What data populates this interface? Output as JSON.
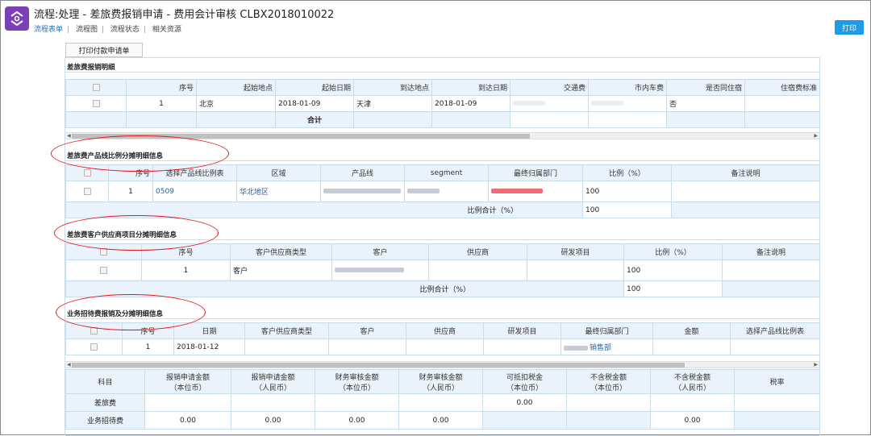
{
  "header": {
    "title": "流程:处理 - 差旅费报销申请 - 费用会计审核 CLBX2018010022",
    "tabs": [
      "流程表单",
      "流程图",
      "流程状态",
      "相关资源"
    ],
    "separator": "|",
    "print_label": "打印",
    "pay_button_label": "打印付款申请单"
  },
  "icons": {
    "logo": "flow-exchange-icon",
    "checkbox": "checkbox-icon"
  },
  "colors": {
    "brand": "#7b3fb8",
    "print": "#1d9be6",
    "header_bg": "#eaf3fb",
    "annotation": "#e0161b"
  },
  "travel": {
    "section_title": "差旅费报销明细",
    "columns": [
      "",
      "序号",
      "起始地点",
      "起始日期",
      "到达地点",
      "到达日期",
      "交通费",
      "市内车费",
      "是否同住宿",
      "住宿费标准"
    ],
    "row": {
      "seq": "1",
      "from": "北京",
      "from_date": "2018-01-09",
      "to": "天津",
      "to_date": "2018-01-09",
      "same_lodging": "否"
    },
    "total_label": "合计"
  },
  "product": {
    "section_title": "差旅费产品线比例分摊明细信息",
    "columns": [
      "",
      "序号",
      "选择产品线比例表",
      "区域",
      "产品线",
      "segment",
      "最终归属部门",
      "比例（%）",
      "备注说明"
    ],
    "row": {
      "seq": "1",
      "table": "0509",
      "region": "华北地区",
      "ratio": "100"
    },
    "total_label": "比例合计（%）",
    "total_value": "100"
  },
  "customer": {
    "section_title": "差旅费客户供应商项目分摊明细信息",
    "columns": [
      "",
      "序号",
      "客户供应商类型",
      "客户",
      "供应商",
      "研发项目",
      "比例（%）",
      "备注说明"
    ],
    "row": {
      "seq": "1",
      "type": "客户",
      "ratio": "100"
    },
    "total_label": "比例合计（%）",
    "total_value": "100"
  },
  "entertain": {
    "section_title": "业务招待费报销及分摊明细信息",
    "columns": [
      "",
      "序号",
      "日期",
      "客户供应商类型",
      "客户",
      "供应商",
      "研发项目",
      "最终归属部门",
      "金额",
      "选择产品线比例表"
    ],
    "row": {
      "seq": "1",
      "date": "2018-01-12",
      "dept_suffix": "销售部"
    }
  },
  "summary": {
    "columns": [
      {
        "l1": "科目",
        "l2": ""
      },
      {
        "l1": "报销申请金额",
        "l2": "（本位币）"
      },
      {
        "l1": "报销申请金额",
        "l2": "（人民币）"
      },
      {
        "l1": "财务审核金额",
        "l2": "（本位币）"
      },
      {
        "l1": "财务审核金额",
        "l2": "（人民币）"
      },
      {
        "l1": "可抵扣税金",
        "l2": "（本位币）"
      },
      {
        "l1": "不含税金额",
        "l2": "（本位币）"
      },
      {
        "l1": "不含税金额",
        "l2": "（人民币）"
      },
      {
        "l1": "税率",
        "l2": ""
      }
    ],
    "rows": [
      {
        "subject": "差旅费",
        "deductible_tax": "0.00"
      },
      {
        "subject": "业务招待费",
        "apply_base": "0.00",
        "apply_rmb": "0.00",
        "audit_base": "0.00",
        "audit_rmb": "0.00",
        "net_rmb": "0.00"
      }
    ]
  }
}
